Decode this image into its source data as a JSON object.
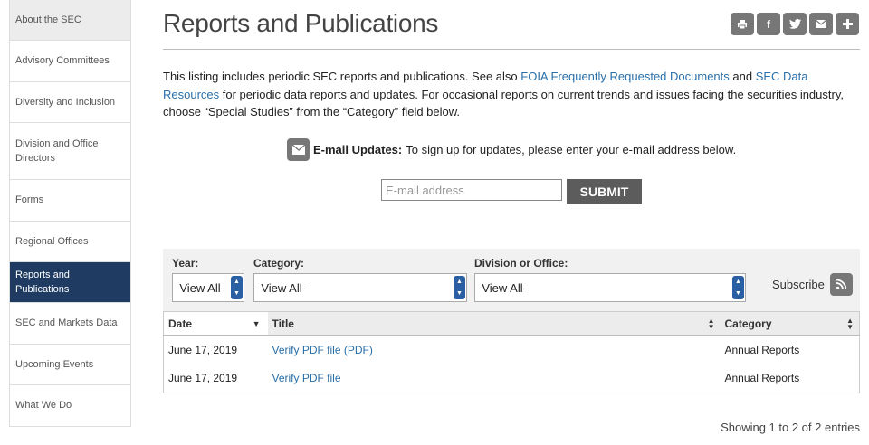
{
  "sidebar": {
    "items": [
      {
        "label": "About the SEC"
      },
      {
        "label": "Advisory Committees"
      },
      {
        "label": "Diversity and Inclusion"
      },
      {
        "label": "Division and Office Directors"
      },
      {
        "label": "Forms"
      },
      {
        "label": "Regional Offices"
      },
      {
        "label": "Reports and Publications"
      },
      {
        "label": "SEC and Markets Data"
      },
      {
        "label": "Upcoming Events"
      },
      {
        "label": "What We Do"
      }
    ]
  },
  "header": {
    "title": "Reports and Publications",
    "share_icons": [
      "print-icon",
      "facebook-icon",
      "twitter-icon",
      "email-icon",
      "plus-icon"
    ]
  },
  "intro": {
    "text1": "This listing includes periodic SEC reports and publications. See also ",
    "link1": "FOIA Frequently Requested Documents",
    "text2": " and ",
    "link2": "SEC Data Resources",
    "text3": " for periodic data reports and updates. For occasional reports on current trends and issues facing the securities industry, choose “Special Studies” from the “Category” field below."
  },
  "email": {
    "label": "E-mail Updates:",
    "text": " To sign up for updates, please enter your e-mail address below.",
    "placeholder": "E-mail address",
    "submit_label": "SUBMIT"
  },
  "filters": {
    "year_label": "Year:",
    "year_value": "-View All-",
    "category_label": "Category:",
    "category_value": "-View All-",
    "division_label": "Division or Office:",
    "division_value": "-View All-",
    "subscribe_label": "Subscribe"
  },
  "table": {
    "columns": [
      "Date",
      "Title",
      "Category"
    ],
    "rows": [
      {
        "date": "June 17, 2019",
        "title": "Verify PDF file (PDF)",
        "category": "Annual Reports"
      },
      {
        "date": "June 17, 2019",
        "title": "Verify PDF file",
        "category": "Annual Reports"
      }
    ],
    "info": "Showing 1 to 2 of 2 entries"
  },
  "colors": {
    "active_nav": "#1f3b61",
    "link": "#2a6fa8",
    "button": "#777777",
    "spinner": "#2b5fa3"
  }
}
